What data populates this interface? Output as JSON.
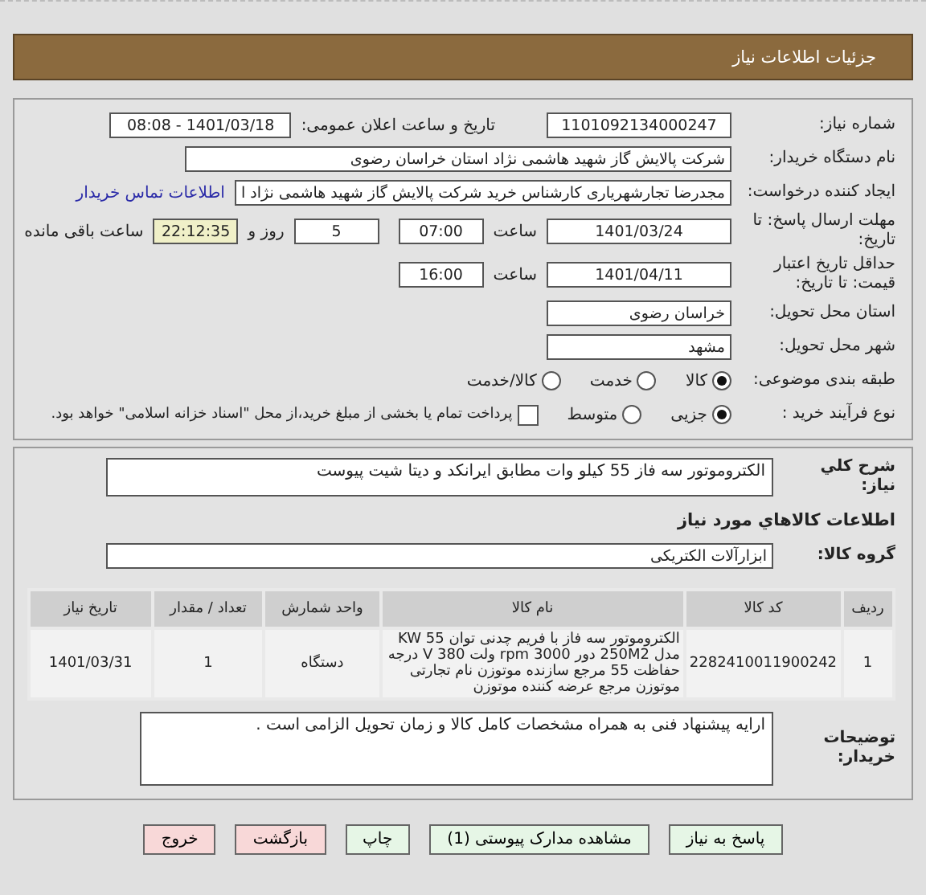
{
  "header": {
    "title": "جزئیات اطلاعات نیاز"
  },
  "need_number": {
    "label": "شماره نیاز:",
    "value": "1101092134000247"
  },
  "announce": {
    "label": "تاریخ و ساعت اعلان عمومی:",
    "value": "1401/03/18 - 08:08"
  },
  "buyer_org": {
    "label": "نام دستگاه خریدار:",
    "value": "شرکت پالایش گاز شهید هاشمی نژاد   استان خراسان رضوی"
  },
  "creator": {
    "label": "ایجاد کننده درخواست:",
    "value": "مجدرضا تجارشهریاری کارشناس خرید شرکت پالایش گاز شهید هاشمی نژاد   ا",
    "link": "اطلاعات تماس خریدار"
  },
  "deadline": {
    "label": "مهلت ارسال پاسخ: تا تاریخ:",
    "date": "1401/03/24",
    "time_label": "ساعت",
    "time": "07:00",
    "days": "5",
    "days_label": "روز و",
    "remaining": "22:12:35",
    "remaining_label": "ساعت باقی مانده"
  },
  "validity": {
    "label": "حداقل تاریخ اعتبار قیمت: تا تاریخ:",
    "date": "1401/04/11",
    "time_label": "ساعت",
    "time": "16:00"
  },
  "province": {
    "label": "استان محل تحویل:",
    "value": "خراسان رضوی"
  },
  "city": {
    "label": "شهر محل تحویل:",
    "value": "مشهد"
  },
  "category": {
    "label": "طبقه بندی موضوعی:",
    "options": [
      {
        "label": "کالا",
        "selected": true
      },
      {
        "label": "خدمت",
        "selected": false
      },
      {
        "label": "کالا/خدمت",
        "selected": false
      }
    ]
  },
  "process": {
    "label": "نوع فرآیند خرید :",
    "options": [
      {
        "label": "جزیی",
        "selected": true
      },
      {
        "label": "متوسط",
        "selected": false
      }
    ],
    "treasury": {
      "label": "پرداخت تمام یا بخشی از مبلغ خرید،از محل \"اسناد خزانه اسلامی\" خواهد بود.",
      "checked": false
    }
  },
  "summary": {
    "label": "شرح کلي نياز:",
    "value": "الکتروموتور سه فاز 55 کیلو وات مطابق ایرانکد و دیتا شیت پیوست"
  },
  "goods_title": "اطلاعات کالاهاي مورد نياز",
  "goods_group": {
    "label": "گروه کالا:",
    "value": "ابزارآلات الکتریکی"
  },
  "table": {
    "columns": [
      "ردیف",
      "کد کالا",
      "نام کالا",
      "واحد شمارش",
      "تعداد / مقدار",
      "تاریخ نیاز"
    ],
    "rows": [
      [
        "1",
        "2282410011900242",
        "الکتروموتور سه فاز با فریم چدنی توان KW 55 مدل 250M2 دور 3000 rpm ولت 380 V درجه حفاظت 55 مرجع سازنده موتوزن نام تجارتی موتوزن مرجع عرضه کننده موتوزن",
        "دستگاه",
        "1",
        "1401/03/31"
      ]
    ]
  },
  "buyer_notes": {
    "label": "توضیحات خریدار:",
    "value": "ارایه پیشنهاد فنی به همراه مشخصات کامل کالا و زمان تحویل الزامی است ."
  },
  "buttons": [
    {
      "label": "پاسخ به نیاز",
      "kind": "green"
    },
    {
      "label": "مشاهده مدارک پیوستی (1)",
      "kind": "green"
    },
    {
      "label": "چاپ",
      "kind": "green"
    },
    {
      "label": "بازگشت",
      "kind": "red"
    },
    {
      "label": "خروج",
      "kind": "red"
    }
  ]
}
